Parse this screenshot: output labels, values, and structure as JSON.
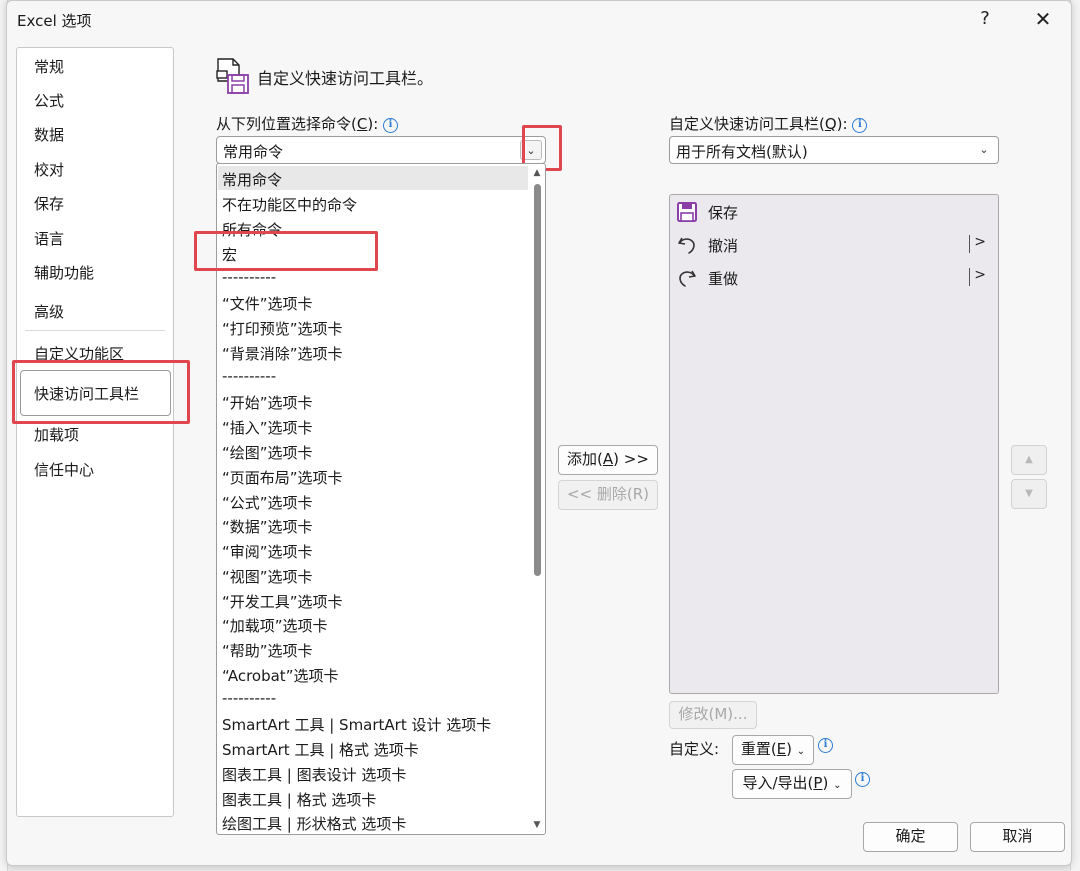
{
  "dialog": {
    "title": "Excel 选项",
    "help_glyph": "?",
    "close_glyph": "✕"
  },
  "nav": {
    "items": [
      "常规",
      "公式",
      "数据",
      "校对",
      "保存",
      "语言",
      "辅助功能",
      "高级",
      "自定义功能区",
      "快速访问工具栏",
      "加载项",
      "信任中心"
    ],
    "selected": "快速访问工具栏"
  },
  "header": {
    "title": "自定义快速访问工具栏。",
    "icon": "qat-customize-icon"
  },
  "left_panel": {
    "label": "从下列位置选择命令(",
    "label_key": "C",
    "label_suffix": "):",
    "select_value": "常用命令",
    "dropdown_options": [
      "常用命令",
      "不在功能区中的命令",
      "所有命令",
      "宏",
      "----------",
      "“文件”选项卡",
      "“打印预览”选项卡",
      "“背景消除”选项卡",
      "----------",
      "“开始”选项卡",
      "“插入”选项卡",
      "“绘图”选项卡",
      "“页面布局”选项卡",
      "“公式”选项卡",
      "“数据”选项卡",
      "“审阅”选项卡",
      "“视图”选项卡",
      "“开发工具”选项卡",
      "“加载项”选项卡",
      "“帮助”选项卡",
      "“Acrobat”选项卡",
      "----------",
      "SmartArt 工具 | SmartArt 设计 选项卡",
      "SmartArt 工具 | 格式 选项卡",
      "图表工具 | 图表设计 选项卡",
      "图表工具 | 格式 选项卡",
      "绘图工具 | 形状格式 选项卡"
    ],
    "highlighted_option": "宏"
  },
  "middle": {
    "add_label": "添加(",
    "add_key": "A",
    "add_suffix": ") >>",
    "remove_label": "<< 删除(R)"
  },
  "right_panel": {
    "label": "自定义快速访问工具栏(",
    "label_key": "Q",
    "label_suffix": "):",
    "select_value": "用于所有文档(默认)",
    "items": [
      {
        "label": "保存",
        "icon": "save-icon",
        "has_submenu": false
      },
      {
        "label": "撤消",
        "icon": "undo-icon",
        "has_submenu": true
      },
      {
        "label": "重做",
        "icon": "redo-icon",
        "has_submenu": true
      }
    ],
    "submenu_glyph": ">",
    "modify_label": "修改(M)...",
    "customize_label": "自定义:",
    "reset_label": "重置(",
    "reset_key": "E",
    "reset_suffix": ")",
    "import_export_label": "导入/导出(",
    "import_export_key": "P",
    "import_export_suffix": ")",
    "move_up_glyph": "▲",
    "move_down_glyph": "▼"
  },
  "footer": {
    "ok_label": "确定",
    "cancel_label": "取消"
  },
  "colors": {
    "highlight_box": "#e0464d",
    "accent_purple": "#8a3ea8",
    "info_blue": "#2b7cd3"
  }
}
